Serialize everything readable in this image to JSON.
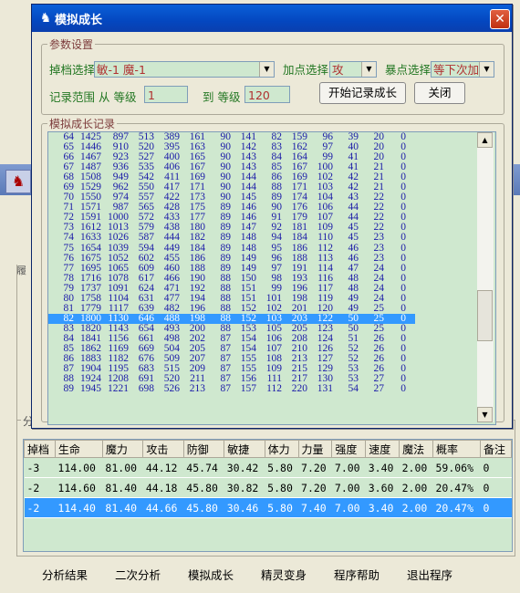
{
  "dialog": {
    "title": "模拟成长",
    "close_glyph": "✕",
    "params_group": "参数设置",
    "slot_label": "掉档选择",
    "slot_value": "敏-1 魔-1",
    "add_label": "加点选择",
    "add_value": "攻",
    "fail_label": "暴点选择",
    "fail_value": "等下次加",
    "range_label": "记录范围 从 等级",
    "range_from": "1",
    "range_to_label": "到 等级",
    "range_to": "120",
    "start_button": "开始记录成长",
    "close_button": "关闭",
    "log_group": "模拟成长记录",
    "selected_row": 18,
    "log_rows": [
      [
        "64",
        "1425",
        "897",
        "513",
        "389",
        "161",
        "90",
        "141",
        "82",
        "159",
        "96",
        "39",
        "20",
        "0"
      ],
      [
        "65",
        "1446",
        "910",
        "520",
        "395",
        "163",
        "90",
        "142",
        "83",
        "162",
        "97",
        "40",
        "20",
        "0"
      ],
      [
        "66",
        "1467",
        "923",
        "527",
        "400",
        "165",
        "90",
        "143",
        "84",
        "164",
        "99",
        "41",
        "20",
        "0"
      ],
      [
        "67",
        "1487",
        "936",
        "535",
        "406",
        "167",
        "90",
        "143",
        "85",
        "167",
        "100",
        "41",
        "21",
        "0"
      ],
      [
        "68",
        "1508",
        "949",
        "542",
        "411",
        "169",
        "90",
        "144",
        "86",
        "169",
        "102",
        "42",
        "21",
        "0"
      ],
      [
        "69",
        "1529",
        "962",
        "550",
        "417",
        "171",
        "90",
        "144",
        "88",
        "171",
        "103",
        "42",
        "21",
        "0"
      ],
      [
        "70",
        "1550",
        "974",
        "557",
        "422",
        "173",
        "90",
        "145",
        "89",
        "174",
        "104",
        "43",
        "22",
        "0"
      ],
      [
        "71",
        "1571",
        "987",
        "565",
        "428",
        "175",
        "89",
        "146",
        "90",
        "176",
        "106",
        "44",
        "22",
        "0"
      ],
      [
        "72",
        "1591",
        "1000",
        "572",
        "433",
        "177",
        "89",
        "146",
        "91",
        "179",
        "107",
        "44",
        "22",
        "0"
      ],
      [
        "73",
        "1612",
        "1013",
        "579",
        "438",
        "180",
        "89",
        "147",
        "92",
        "181",
        "109",
        "45",
        "22",
        "0"
      ],
      [
        "74",
        "1633",
        "1026",
        "587",
        "444",
        "182",
        "89",
        "148",
        "94",
        "184",
        "110",
        "45",
        "23",
        "0"
      ],
      [
        "75",
        "1654",
        "1039",
        "594",
        "449",
        "184",
        "89",
        "148",
        "95",
        "186",
        "112",
        "46",
        "23",
        "0"
      ],
      [
        "76",
        "1675",
        "1052",
        "602",
        "455",
        "186",
        "89",
        "149",
        "96",
        "188",
        "113",
        "46",
        "23",
        "0"
      ],
      [
        "77",
        "1695",
        "1065",
        "609",
        "460",
        "188",
        "89",
        "149",
        "97",
        "191",
        "114",
        "47",
        "24",
        "0"
      ],
      [
        "78",
        "1716",
        "1078",
        "617",
        "466",
        "190",
        "88",
        "150",
        "98",
        "193",
        "116",
        "48",
        "24",
        "0"
      ],
      [
        "79",
        "1737",
        "1091",
        "624",
        "471",
        "192",
        "88",
        "151",
        "99",
        "196",
        "117",
        "48",
        "24",
        "0"
      ],
      [
        "80",
        "1758",
        "1104",
        "631",
        "477",
        "194",
        "88",
        "151",
        "101",
        "198",
        "119",
        "49",
        "24",
        "0"
      ],
      [
        "81",
        "1779",
        "1117",
        "639",
        "482",
        "196",
        "88",
        "152",
        "102",
        "201",
        "120",
        "49",
        "25",
        "0"
      ],
      [
        "82",
        "1800",
        "1130",
        "646",
        "488",
        "198",
        "88",
        "152",
        "103",
        "203",
        "122",
        "50",
        "25",
        "0"
      ],
      [
        "83",
        "1820",
        "1143",
        "654",
        "493",
        "200",
        "88",
        "153",
        "105",
        "205",
        "123",
        "50",
        "25",
        "0"
      ],
      [
        "84",
        "1841",
        "1156",
        "661",
        "498",
        "202",
        "87",
        "154",
        "106",
        "208",
        "124",
        "51",
        "26",
        "0"
      ],
      [
        "85",
        "1862",
        "1169",
        "669",
        "504",
        "205",
        "87",
        "154",
        "107",
        "210",
        "126",
        "52",
        "26",
        "0"
      ],
      [
        "86",
        "1883",
        "1182",
        "676",
        "509",
        "207",
        "87",
        "155",
        "108",
        "213",
        "127",
        "52",
        "26",
        "0"
      ],
      [
        "87",
        "1904",
        "1195",
        "683",
        "515",
        "209",
        "87",
        "155",
        "109",
        "215",
        "129",
        "53",
        "26",
        "0"
      ],
      [
        "88",
        "1924",
        "1208",
        "691",
        "520",
        "211",
        "87",
        "156",
        "111",
        "217",
        "130",
        "53",
        "27",
        "0"
      ],
      [
        "89",
        "1945",
        "1221",
        "698",
        "526",
        "213",
        "87",
        "157",
        "112",
        "220",
        "131",
        "54",
        "27",
        "0"
      ]
    ]
  },
  "main": {
    "group_label": "分",
    "left_label": "履",
    "columns": [
      "掉档",
      "生命",
      "魔力",
      "攻击",
      "防御",
      "敏捷",
      "体力",
      "力量",
      "强度",
      "速度",
      "魔法",
      "概率",
      "备注"
    ],
    "rows": [
      [
        "-3",
        "114.00",
        "81.00",
        "44.12",
        "45.74",
        "30.42",
        "5.80",
        "7.20",
        "7.00",
        "3.40",
        "2.00",
        "59.06%",
        "0"
      ],
      [
        "-2",
        "114.60",
        "81.40",
        "44.18",
        "45.80",
        "30.82",
        "5.80",
        "7.20",
        "7.00",
        "3.60",
        "2.00",
        "20.47%",
        "0"
      ],
      [
        "-2",
        "114.40",
        "81.40",
        "44.66",
        "45.80",
        "30.46",
        "5.80",
        "7.40",
        "7.00",
        "3.40",
        "2.00",
        "20.47%",
        "0"
      ]
    ],
    "bottom_buttons": [
      "分析结果",
      "二次分析",
      "模拟成长",
      "精灵变身",
      "程序帮助",
      "退出程序"
    ]
  }
}
